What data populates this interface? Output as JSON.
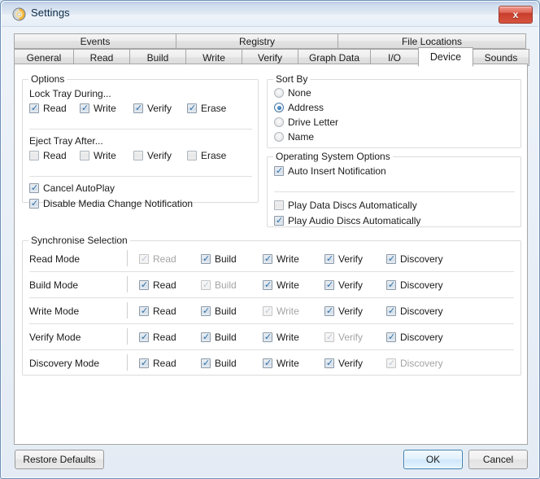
{
  "window": {
    "title": "Settings",
    "icon": "disc-icon",
    "close_label": "x",
    "accent_blue": "#2d6ea8",
    "close_red": "#c73e2c"
  },
  "tabs": {
    "row1": [
      {
        "label": "Events"
      },
      {
        "label": "Registry"
      },
      {
        "label": "File Locations"
      }
    ],
    "row2": [
      {
        "label": "General"
      },
      {
        "label": "Read"
      },
      {
        "label": "Build"
      },
      {
        "label": "Write"
      },
      {
        "label": "Verify"
      },
      {
        "label": "Graph Data"
      },
      {
        "label": "I/O"
      },
      {
        "label": "Device"
      },
      {
        "label": "Sounds"
      }
    ],
    "selected": "Device"
  },
  "options": {
    "legend": "Options",
    "lock_tray_label": "Lock Tray During...",
    "lock_tray": [
      {
        "label": "Read",
        "checked": true
      },
      {
        "label": "Write",
        "checked": true
      },
      {
        "label": "Verify",
        "checked": true
      },
      {
        "label": "Erase",
        "checked": true
      }
    ],
    "eject_tray_label": "Eject Tray After...",
    "eject_tray": [
      {
        "label": "Read",
        "checked": false
      },
      {
        "label": "Write",
        "checked": false
      },
      {
        "label": "Verify",
        "checked": false
      },
      {
        "label": "Erase",
        "checked": false
      }
    ],
    "misc": [
      {
        "label": "Cancel AutoPlay",
        "checked": true
      },
      {
        "label": "Disable Media Change Notification",
        "checked": true
      }
    ]
  },
  "sort_by": {
    "legend": "Sort By",
    "items": [
      {
        "label": "None",
        "selected": false
      },
      {
        "label": "Address",
        "selected": true
      },
      {
        "label": "Drive Letter",
        "selected": false
      },
      {
        "label": "Name",
        "selected": false
      }
    ]
  },
  "os_options": {
    "legend": "Operating System Options",
    "items": [
      {
        "label": "Auto Insert Notification",
        "checked": true
      }
    ],
    "items2": [
      {
        "label": "Play Data Discs Automatically",
        "checked": false
      },
      {
        "label": "Play Audio Discs Automatically",
        "checked": true
      }
    ]
  },
  "sync": {
    "legend": "Synchronise Selection",
    "columns": [
      "Read",
      "Build",
      "Write",
      "Verify",
      "Discovery"
    ],
    "rows": [
      {
        "label": "Read Mode",
        "cells": [
          {
            "label": "Read",
            "checked": true,
            "disabled": true
          },
          {
            "label": "Build",
            "checked": true,
            "disabled": false
          },
          {
            "label": "Write",
            "checked": true,
            "disabled": false
          },
          {
            "label": "Verify",
            "checked": true,
            "disabled": false
          },
          {
            "label": "Discovery",
            "checked": true,
            "disabled": false
          }
        ]
      },
      {
        "label": "Build Mode",
        "cells": [
          {
            "label": "Read",
            "checked": true,
            "disabled": false
          },
          {
            "label": "Build",
            "checked": true,
            "disabled": true
          },
          {
            "label": "Write",
            "checked": true,
            "disabled": false
          },
          {
            "label": "Verify",
            "checked": true,
            "disabled": false
          },
          {
            "label": "Discovery",
            "checked": true,
            "disabled": false
          }
        ]
      },
      {
        "label": "Write Mode",
        "cells": [
          {
            "label": "Read",
            "checked": true,
            "disabled": false
          },
          {
            "label": "Build",
            "checked": true,
            "disabled": false
          },
          {
            "label": "Write",
            "checked": true,
            "disabled": true
          },
          {
            "label": "Verify",
            "checked": true,
            "disabled": false
          },
          {
            "label": "Discovery",
            "checked": true,
            "disabled": false
          }
        ]
      },
      {
        "label": "Verify Mode",
        "cells": [
          {
            "label": "Read",
            "checked": true,
            "disabled": false
          },
          {
            "label": "Build",
            "checked": true,
            "disabled": false
          },
          {
            "label": "Write",
            "checked": true,
            "disabled": false
          },
          {
            "label": "Verify",
            "checked": true,
            "disabled": true
          },
          {
            "label": "Discovery",
            "checked": true,
            "disabled": false
          }
        ]
      },
      {
        "label": "Discovery Mode",
        "cells": [
          {
            "label": "Read",
            "checked": true,
            "disabled": false
          },
          {
            "label": "Build",
            "checked": true,
            "disabled": false
          },
          {
            "label": "Write",
            "checked": true,
            "disabled": false
          },
          {
            "label": "Verify",
            "checked": true,
            "disabled": false
          },
          {
            "label": "Discovery",
            "checked": true,
            "disabled": true
          }
        ]
      }
    ]
  },
  "footer": {
    "restore_defaults": "Restore Defaults",
    "ok": "OK",
    "cancel": "Cancel"
  }
}
